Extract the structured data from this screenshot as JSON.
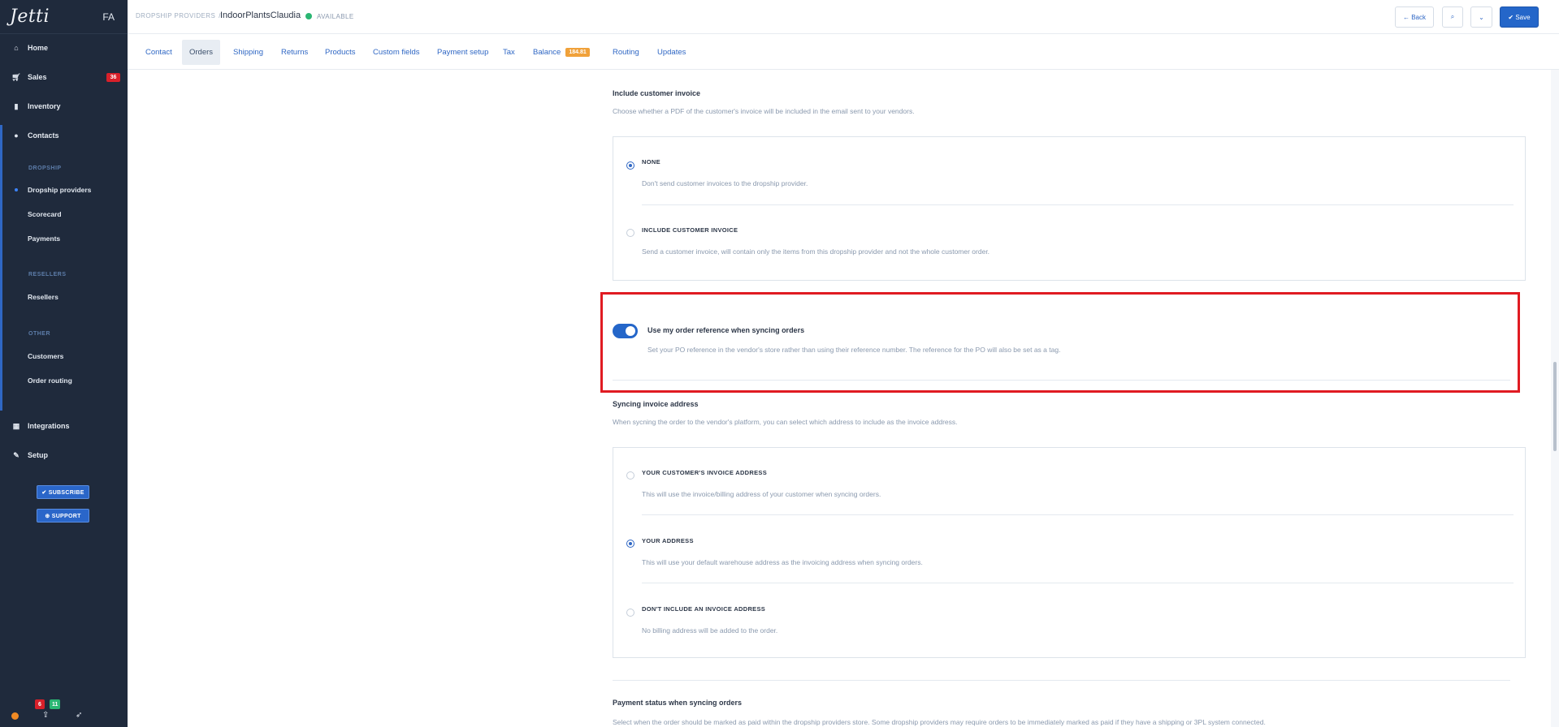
{
  "sidebar": {
    "logo": "Jetti",
    "user_initials": "FA",
    "nav": [
      {
        "label": "Home",
        "icon": "home-icon"
      },
      {
        "label": "Sales",
        "icon": "cart-icon",
        "badge": "36"
      },
      {
        "label": "Inventory",
        "icon": "bookmark-icon"
      },
      {
        "label": "Contacts",
        "icon": "user-icon"
      }
    ],
    "sections": {
      "dropship_label": "DROPSHIP",
      "dropship_items": [
        "Dropship providers",
        "Scorecard",
        "Payments"
      ],
      "resellers_label": "RESELLERS",
      "resellers_items": [
        "Resellers"
      ],
      "other_label": "OTHER",
      "other_items": [
        "Customers",
        "Order routing"
      ]
    },
    "nav_bottom": [
      {
        "label": "Integrations",
        "icon": "grid-icon"
      },
      {
        "label": "Setup",
        "icon": "wrench-icon"
      }
    ],
    "subscribe_label": "✔ SUBSCRIBE",
    "support_label": "⊕ SUPPORT",
    "footer_badges": {
      "red": "6",
      "green": "11"
    }
  },
  "header": {
    "breadcrumb": "DROPSHIP PROVIDERS",
    "title": "IndoorPlantsClaudia",
    "status": "AVAILABLE",
    "back_label": "← Back",
    "save_label": "✔ Save"
  },
  "tabs": [
    {
      "label": "Contact"
    },
    {
      "label": "Orders",
      "active": true
    },
    {
      "label": "Shipping"
    },
    {
      "label": "Returns"
    },
    {
      "label": "Products"
    },
    {
      "label": "Custom fields"
    },
    {
      "label": "Payment setup"
    },
    {
      "label": "Tax"
    },
    {
      "label": "Balance",
      "badge": "184.81"
    },
    {
      "label": "Routing"
    },
    {
      "label": "Updates"
    }
  ],
  "invoice_section": {
    "title": "Include customer invoice",
    "description": "Choose whether a PDF of the customer's invoice will be included in the email sent to your vendors.",
    "options": [
      {
        "title": "NONE",
        "desc": "Don't send customer invoices to the dropship provider.",
        "checked": true
      },
      {
        "title": "INCLUDE CUSTOMER INVOICE",
        "desc": "Send a customer invoice, will contain only the items from this dropship provider and not the whole customer order.",
        "checked": false
      }
    ]
  },
  "order_reference": {
    "label": "Use my order reference when syncing orders",
    "description": "Set your PO reference in the vendor's store rather than using their reference number. The reference for the PO will also be set as a tag.",
    "enabled": true
  },
  "syncing_invoice": {
    "title": "Syncing invoice address",
    "description": "When sycning the order to the vendor's platform, you can select which address to include as the invoice address.",
    "options": [
      {
        "title": "YOUR CUSTOMER'S INVOICE ADDRESS",
        "desc": "This will use the invoice/billing address of your customer when syncing orders.",
        "checked": false
      },
      {
        "title": "YOUR ADDRESS",
        "desc": "This will use your default warehouse address as the invoicing address when syncing orders.",
        "checked": true
      },
      {
        "title": "DON'T INCLUDE AN INVOICE ADDRESS",
        "desc": "No billing address will be added to the order.",
        "checked": false
      }
    ]
  },
  "payment_status": {
    "title": "Payment status when syncing orders",
    "description": "Select when the order should be marked as paid within the dropship providers store. Some dropship providers may require orders to be immediately marked as paid if they have a shipping or 3PL system connected."
  },
  "colors": {
    "accent": "#2466c9",
    "sidebar": "#1f2a3c",
    "highlight": "#e01b22",
    "status": "#2bb673"
  }
}
